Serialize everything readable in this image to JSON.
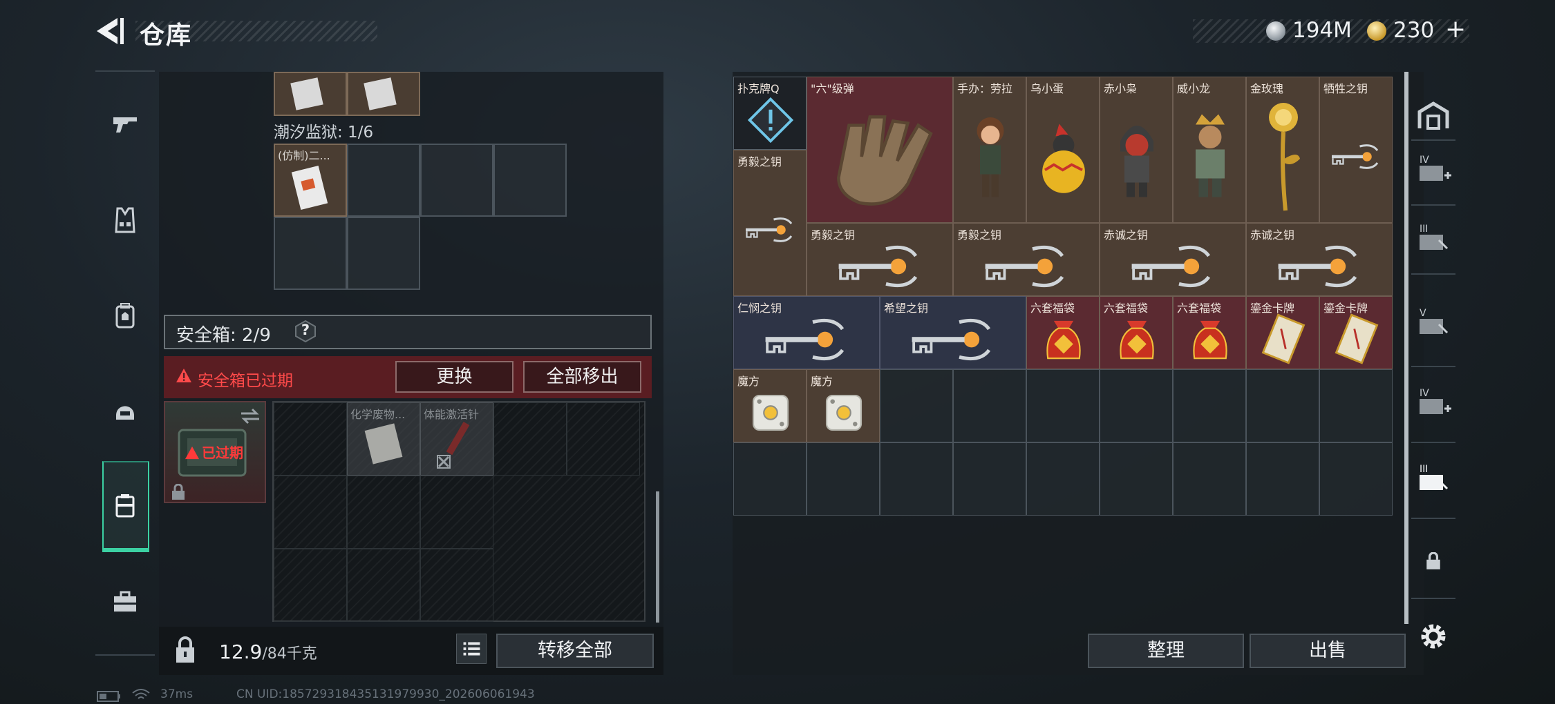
{
  "header": {
    "title": "仓库",
    "currency_silver": "194M",
    "currency_gold": "230",
    "currency_plus": "+"
  },
  "left_nav": {
    "items": [
      {
        "name": "gun-icon"
      },
      {
        "name": "vest-icon"
      },
      {
        "name": "backpack-icon"
      },
      {
        "name": "helmet-icon"
      },
      {
        "name": "safebox-icon",
        "active": true
      },
      {
        "name": "toolbox-icon"
      }
    ]
  },
  "container": {
    "section_label": "潮汐监狱: 1/6",
    "item_label": "(仿制)二..."
  },
  "safebox": {
    "label": "安全箱: 2/9",
    "help": "?",
    "expired_warning": "安全箱已过期",
    "swap_button": "更换",
    "move_all_button": "全部移出",
    "expired_badge": "已过期",
    "items": [
      {
        "label": "化学废物...",
        "icon": "chemical-waste-icon"
      },
      {
        "label": "体能激活针",
        "icon": "syringe-icon"
      }
    ]
  },
  "footer": {
    "weight": "12.9",
    "weight_capacity": "/84千克",
    "transfer_all_button": "转移全部"
  },
  "stash": {
    "items": [
      {
        "label": "扑克牌Q",
        "style": "dark",
        "icon": "poker-card-icon"
      },
      {
        "label": "\"六\"级弹",
        "style": "red",
        "icon": "bullet-hand-icon"
      },
      {
        "label": "手办：劳拉",
        "style": "brown",
        "icon": "figure-lara-icon"
      },
      {
        "label": "乌小蛋",
        "style": "brown",
        "icon": "figure-egg-icon"
      },
      {
        "label": "赤小枭",
        "style": "brown",
        "icon": "figure-red-icon"
      },
      {
        "label": "威小龙",
        "style": "brown",
        "icon": "figure-dragon-icon"
      },
      {
        "label": "金玫瑰",
        "style": "brown",
        "icon": "golden-rose-icon"
      },
      {
        "label": "牺牲之钥",
        "style": "brown",
        "icon": "key-icon"
      },
      {
        "label": "勇毅之钥",
        "style": "brown",
        "icon": "key-icon"
      },
      {
        "label": "勇毅之钥",
        "style": "brown",
        "icon": "key-icon"
      },
      {
        "label": "勇毅之钥",
        "style": "brown",
        "icon": "key-icon"
      },
      {
        "label": "赤诚之钥",
        "style": "brown",
        "icon": "key-icon"
      },
      {
        "label": "赤诚之钥",
        "style": "brown",
        "icon": "key-icon"
      },
      {
        "label": "仁悯之钥",
        "style": "blue",
        "icon": "key-icon"
      },
      {
        "label": "希望之钥",
        "style": "blue",
        "icon": "key-icon"
      },
      {
        "label": "六套福袋",
        "style": "red",
        "icon": "lucky-bag-icon"
      },
      {
        "label": "六套福袋",
        "style": "red",
        "icon": "lucky-bag-icon"
      },
      {
        "label": "六套福袋",
        "style": "red",
        "icon": "lucky-bag-icon"
      },
      {
        "label": "鎏金卡牌",
        "style": "red",
        "icon": "gilded-card-icon"
      },
      {
        "label": "鎏金卡牌",
        "style": "red",
        "icon": "gilded-card-icon"
      },
      {
        "label": "魔方",
        "style": "brown",
        "icon": "magic-cube-icon"
      },
      {
        "label": "魔方",
        "style": "brown",
        "icon": "magic-cube-icon"
      }
    ],
    "sort_button": "整理",
    "sell_button": "出售"
  },
  "right_sidebar": {
    "tabs": [
      "stash-main-icon",
      "IV",
      "III",
      "V",
      "IV",
      "III"
    ]
  },
  "status_bar": {
    "ping": "37ms",
    "uid": "CN UID:18572931843513197993​0_202606061943"
  },
  "colors": {
    "accent": "#3cd1a3",
    "warning": "#ff4a4a",
    "item_brown": "#4c3e33",
    "item_red": "#5b2a31",
    "item_blue": "#2e3446"
  }
}
